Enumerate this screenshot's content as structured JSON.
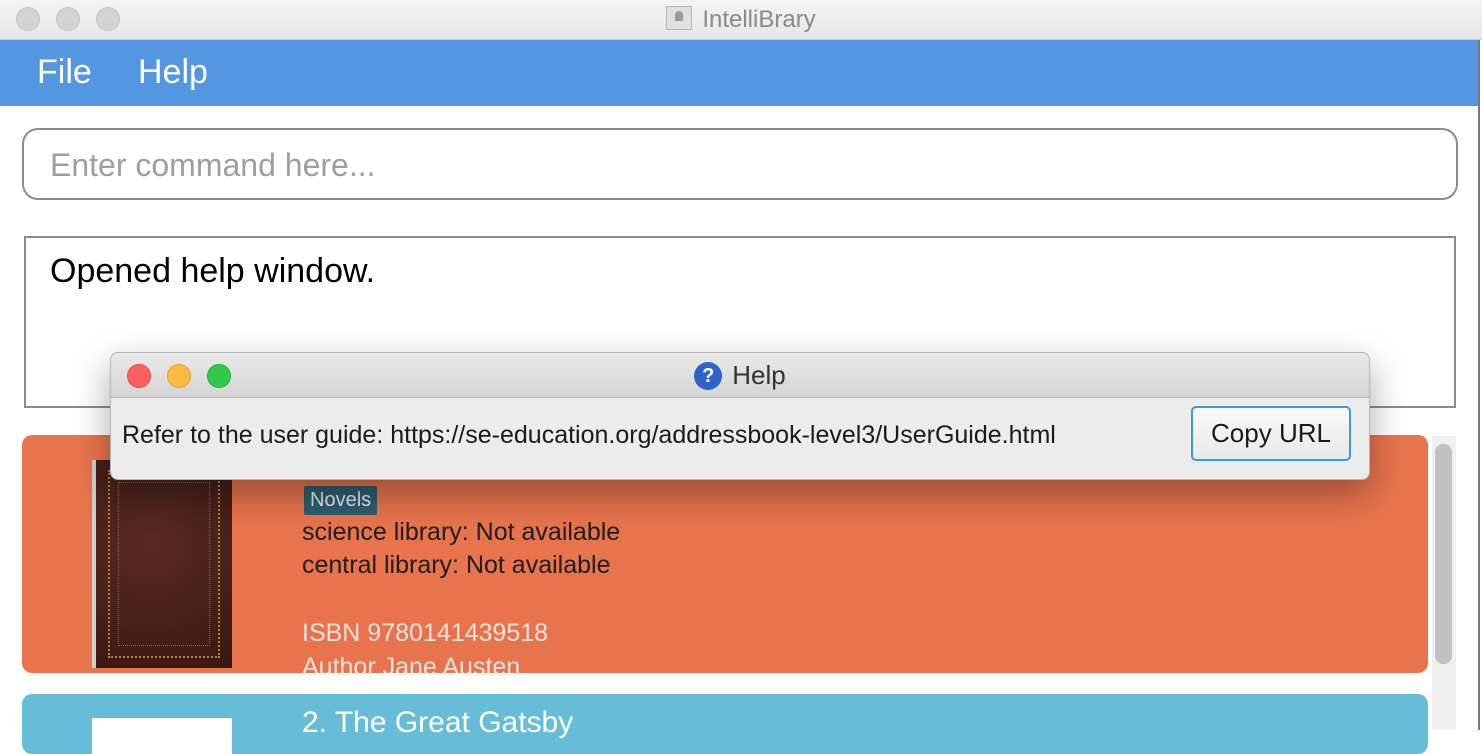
{
  "window": {
    "title": "IntelliBrary"
  },
  "menu": {
    "file": "File",
    "help": "Help"
  },
  "command": {
    "placeholder": "Enter command here..."
  },
  "result": {
    "text": "Opened help window."
  },
  "book1": {
    "tag": "Novels",
    "science_library": "science library: Not available",
    "central_library": "central library: Not available",
    "isbn": "ISBN 9780141439518",
    "author": "Author Jane Austen"
  },
  "book2": {
    "title": "2.  The Great Gatsby"
  },
  "help_dialog": {
    "title": "Help",
    "message": "Refer to the user guide: https://se-education.org/addressbook-level3/UserGuide.html",
    "copy_button": "Copy URL"
  },
  "colors": {
    "menu_bar": "#5497e0",
    "card1": "#e8744d",
    "card2": "#67bdd8",
    "tag": "#2f5d6f",
    "button_focus": "#3a9ae0"
  }
}
